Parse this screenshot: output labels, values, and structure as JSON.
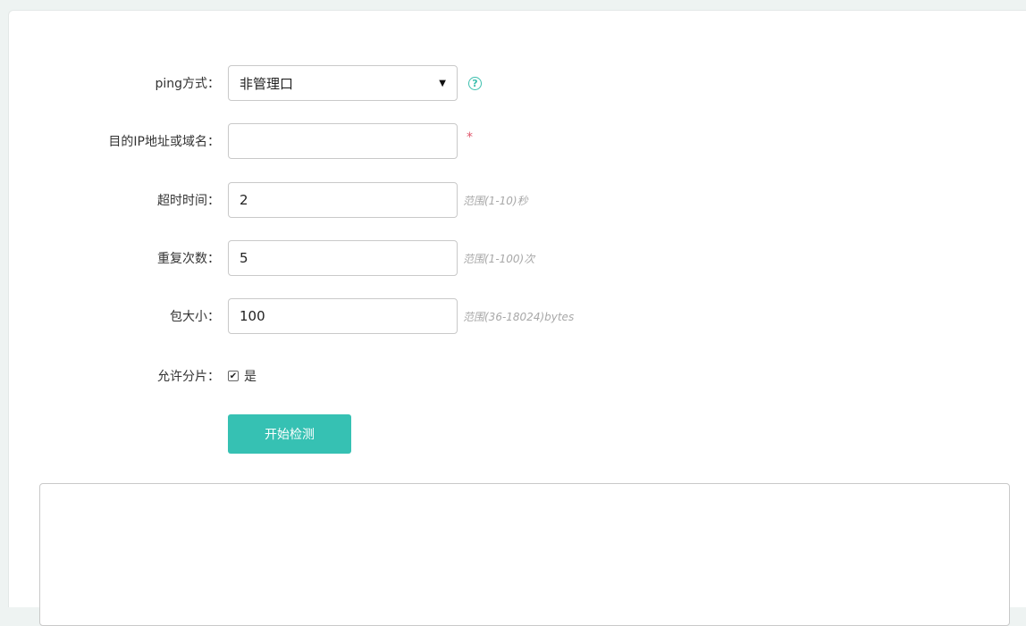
{
  "form": {
    "ping_mode": {
      "label": "ping方式：",
      "value": "非管理口"
    },
    "target": {
      "label": "目的IP地址或域名：",
      "value": "",
      "required_mark": "*"
    },
    "timeout": {
      "label": "超时时间：",
      "value": "2",
      "hint": "范围(1-10)秒"
    },
    "repeat": {
      "label": "重复次数：",
      "value": "5",
      "hint": "范围(1-100)次"
    },
    "packet_size": {
      "label": "包大小：",
      "value": "100",
      "hint": "范围(36-18024)bytes"
    },
    "fragment": {
      "label": "允许分片：",
      "checked": true,
      "option_text": "是"
    },
    "start_button": "开始检测"
  },
  "colors": {
    "accent": "#36c1b3",
    "required": "#e0566b",
    "hint": "#a8a8a8"
  },
  "icons": {
    "help": "help-circle-icon",
    "dropdown": "caret-down-icon",
    "check": "checkmark-icon"
  }
}
